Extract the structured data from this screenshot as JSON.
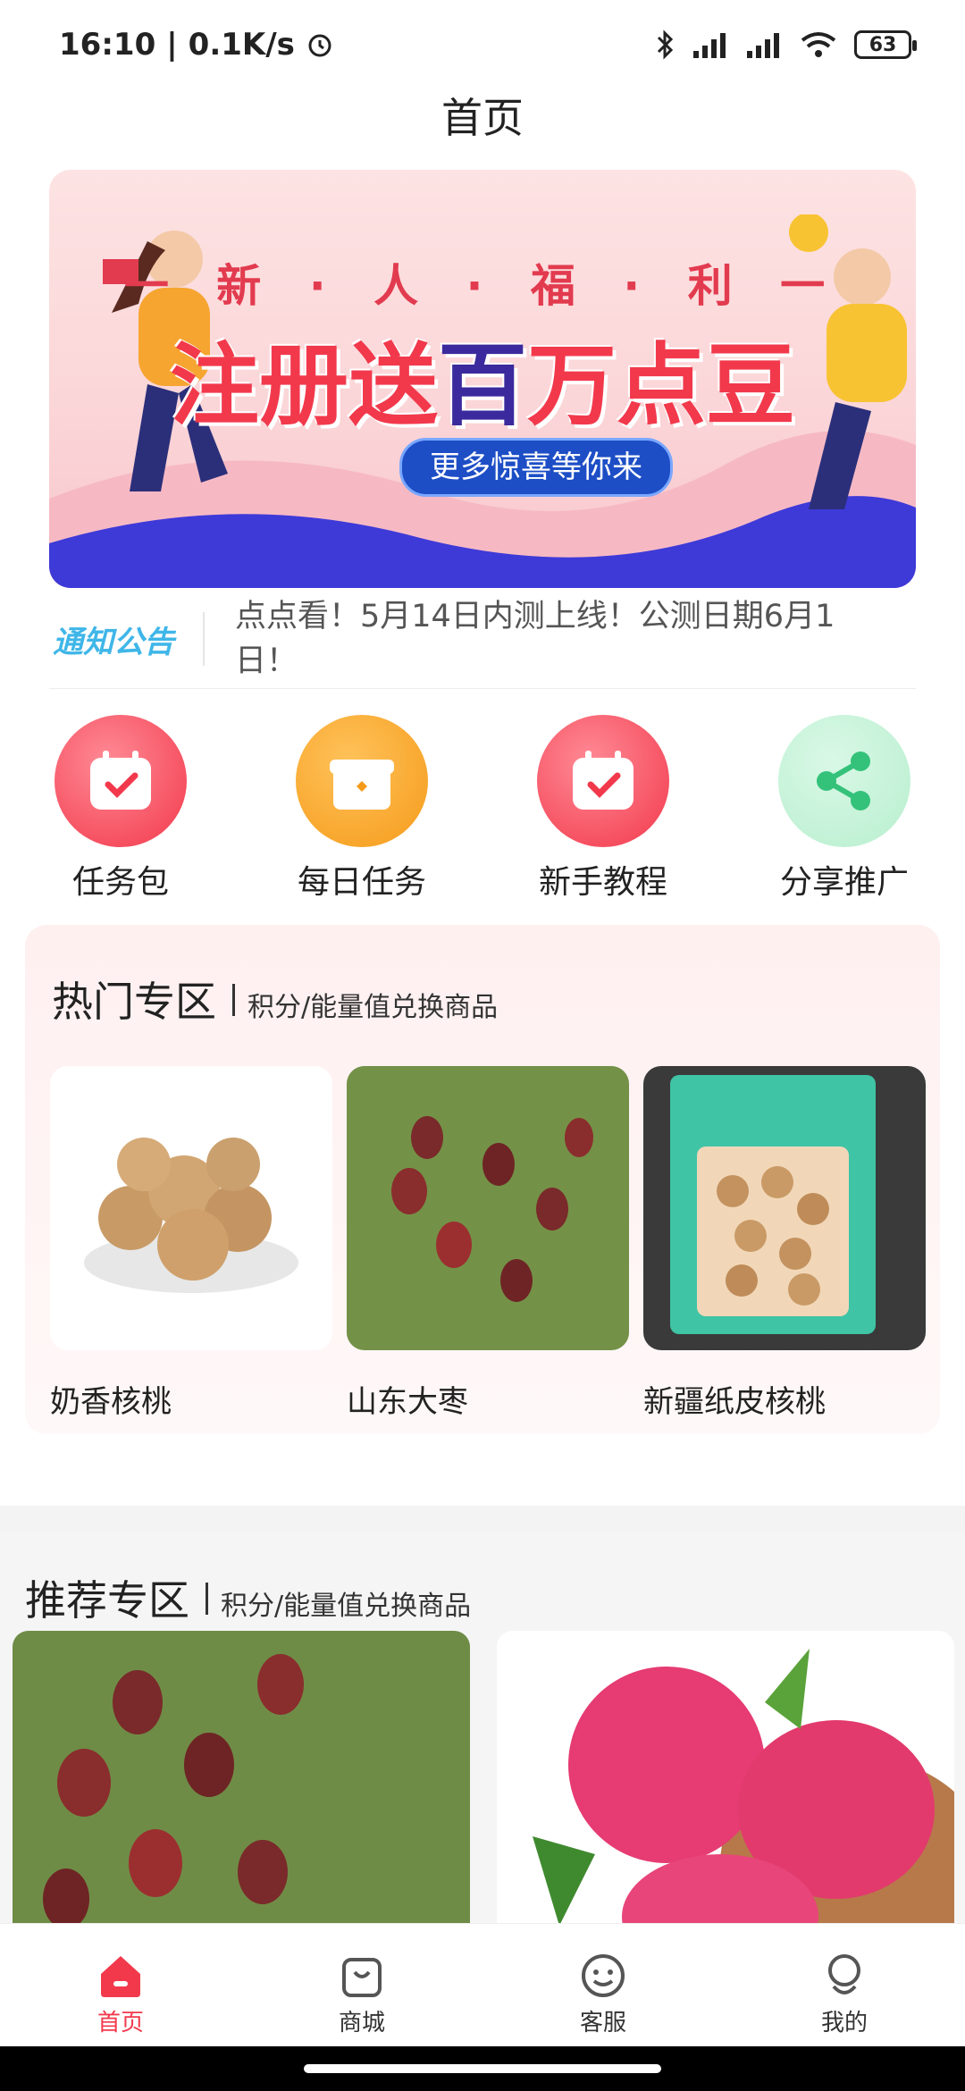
{
  "status_bar": {
    "time": "16:10",
    "speed": "0.1K/s",
    "battery": "63"
  },
  "header": {
    "title": "首页"
  },
  "banner": {
    "subtitle": "一 新 · 人 · 福 · 利 一",
    "headline_part1": "注册送",
    "headline_em": "百",
    "headline_part2": "万点豆",
    "pill": "更多惊喜等你来"
  },
  "notice": {
    "logo_text": "通知公告",
    "text": "点点看！5月14日内测上线！公测日期6月1日！"
  },
  "shortcuts": [
    {
      "label": "任务包",
      "icon": "calendar-check-icon",
      "color": "#f2394c"
    },
    {
      "label": "每日任务",
      "icon": "gift-box-icon",
      "color": "#f59b1a"
    },
    {
      "label": "新手教程",
      "icon": "calendar-check-icon",
      "color": "#f2394c"
    },
    {
      "label": "分享推广",
      "icon": "share-icon",
      "color": "#34c27a"
    }
  ],
  "hot_section": {
    "title": "热门专区",
    "subtitle": "积分/能量值兑换商品",
    "items": [
      {
        "name": "奶香核桃"
      },
      {
        "name": "山东大枣"
      },
      {
        "name": "新疆纸皮核桃"
      }
    ]
  },
  "recommend_section": {
    "title": "推荐专区",
    "subtitle": "积分/能量值兑换商品"
  },
  "tabbar": {
    "items": [
      {
        "label": "首页",
        "icon": "home-icon",
        "active": true
      },
      {
        "label": "商城",
        "icon": "shopping-bag-icon",
        "active": false
      },
      {
        "label": "客服",
        "icon": "smiley-icon",
        "active": false
      },
      {
        "label": "我的",
        "icon": "person-icon",
        "active": false
      }
    ]
  }
}
